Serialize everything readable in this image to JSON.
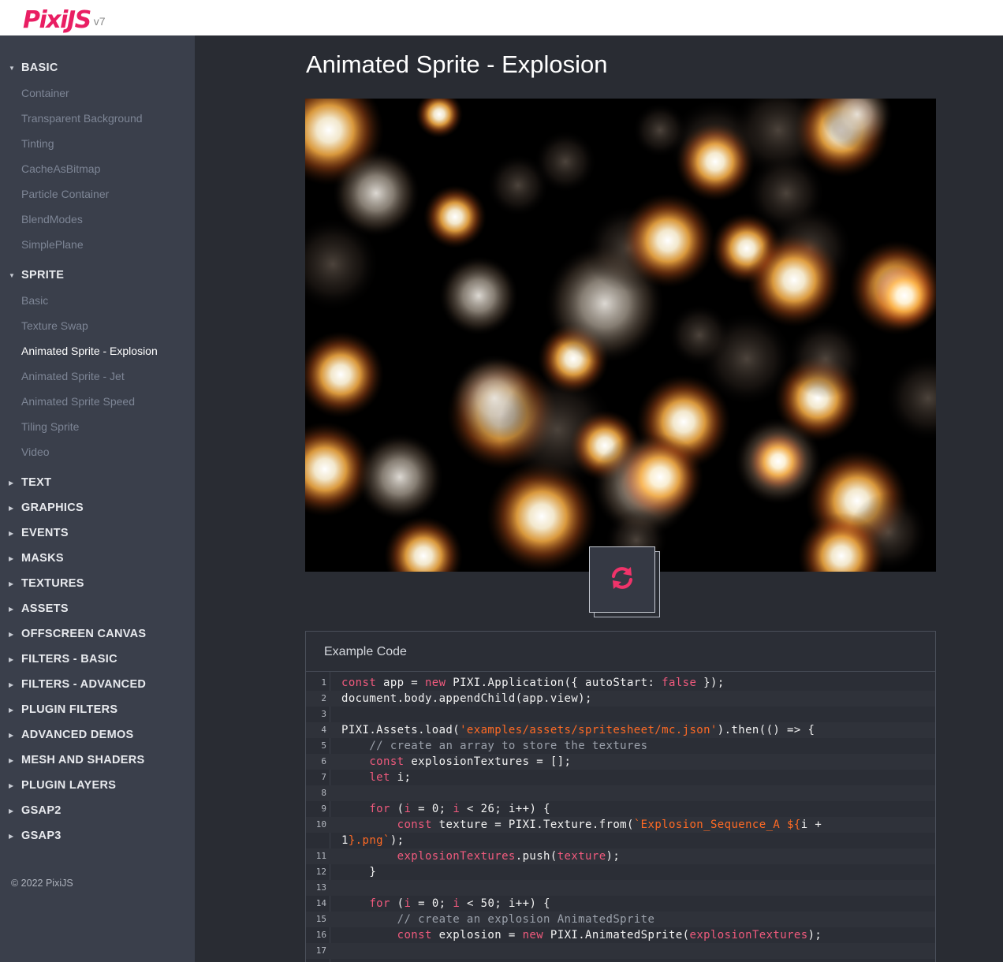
{
  "header": {
    "brand": "PixiJS",
    "version": "v7"
  },
  "sidebar": {
    "sections": [
      {
        "label": "BASIC",
        "expanded": true,
        "items": [
          "Container",
          "Transparent Background",
          "Tinting",
          "CacheAsBitmap",
          "Particle Container",
          "BlendModes",
          "SimplePlane"
        ]
      },
      {
        "label": "SPRITE",
        "expanded": true,
        "items": [
          "Basic",
          "Texture Swap",
          "Animated Sprite - Explosion",
          "Animated Sprite - Jet",
          "Animated Sprite Speed",
          "Tiling Sprite",
          "Video"
        ],
        "active_item": "Animated Sprite - Explosion"
      },
      {
        "label": "TEXT",
        "expanded": false
      },
      {
        "label": "GRAPHICS",
        "expanded": false
      },
      {
        "label": "EVENTS",
        "expanded": false
      },
      {
        "label": "MASKS",
        "expanded": false
      },
      {
        "label": "TEXTURES",
        "expanded": false
      },
      {
        "label": "ASSETS",
        "expanded": false
      },
      {
        "label": "OFFSCREEN CANVAS",
        "expanded": false
      },
      {
        "label": "FILTERS - BASIC",
        "expanded": false
      },
      {
        "label": "FILTERS - ADVANCED",
        "expanded": false
      },
      {
        "label": "PLUGIN FILTERS",
        "expanded": false
      },
      {
        "label": "ADVANCED DEMOS",
        "expanded": false
      },
      {
        "label": "MESH AND SHADERS",
        "expanded": false
      },
      {
        "label": "PLUGIN LAYERS",
        "expanded": false
      },
      {
        "label": "GSAP2",
        "expanded": false
      },
      {
        "label": "GSAP3",
        "expanded": false
      }
    ],
    "copyright": "© 2022 PixiJS"
  },
  "main": {
    "title": "Animated Sprite - Explosion",
    "reload_icon": "refresh-icon",
    "code_panel": {
      "title": "Example Code",
      "lines": [
        {
          "n": "1",
          "html": "<span class=\"kw\">const</span> app = <span class=\"kw\">new</span> PIXI.Application({ autoStart: <span class=\"kw\">false</span> });"
        },
        {
          "n": "2",
          "html": "document.body.appendChild(app.view);"
        },
        {
          "n": "3",
          "html": ""
        },
        {
          "n": "4",
          "html": "PIXI.Assets.load(<span class=\"str\">'examples/assets/spritesheet/mc.json'</span>).then(() => {"
        },
        {
          "n": "5",
          "html": "    <span class=\"cm\">// create an array to store the textures</span>"
        },
        {
          "n": "6",
          "html": "    <span class=\"kw\">const</span> explosionTextures = [];"
        },
        {
          "n": "7",
          "html": "    <span class=\"kw\">let</span> i;"
        },
        {
          "n": "8",
          "html": ""
        },
        {
          "n": "9",
          "html": "    <span class=\"kw\">for</span> (<span class=\"pr\">i</span> = 0; <span class=\"pr\">i</span> < 26; i++) {"
        },
        {
          "n": "10",
          "html": "        <span class=\"kw\">const</span> texture = PIXI.Texture.from(<span class=\"str\">`Explosion_Sequence_A ${</span>i +"
        },
        {
          "n": "",
          "html": "1<span class=\"str\">}.png`</span>);"
        },
        {
          "n": "11",
          "html": "        <span class=\"pr\">explosionTextures</span>.push(<span class=\"pr\">texture</span>);"
        },
        {
          "n": "12",
          "html": "    }"
        },
        {
          "n": "13",
          "html": ""
        },
        {
          "n": "14",
          "html": "    <span class=\"kw\">for</span> (<span class=\"pr\">i</span> = 0; <span class=\"pr\">i</span> < 50; i++) {"
        },
        {
          "n": "15",
          "html": "        <span class=\"cm\">// create an explosion AnimatedSprite</span>"
        },
        {
          "n": "16",
          "html": "        <span class=\"kw\">const</span> explosion = <span class=\"kw\">new</span> PIXI.AnimatedSprite(<span class=\"pr\">explosionTextures</span>);"
        },
        {
          "n": "17",
          "html": ""
        }
      ]
    }
  },
  "colors": {
    "brand": "#e91e63",
    "sidebar_bg": "#3a3f4b",
    "main_bg": "#292c33",
    "keyword": "#f05a7d",
    "string": "#ff6a24"
  }
}
